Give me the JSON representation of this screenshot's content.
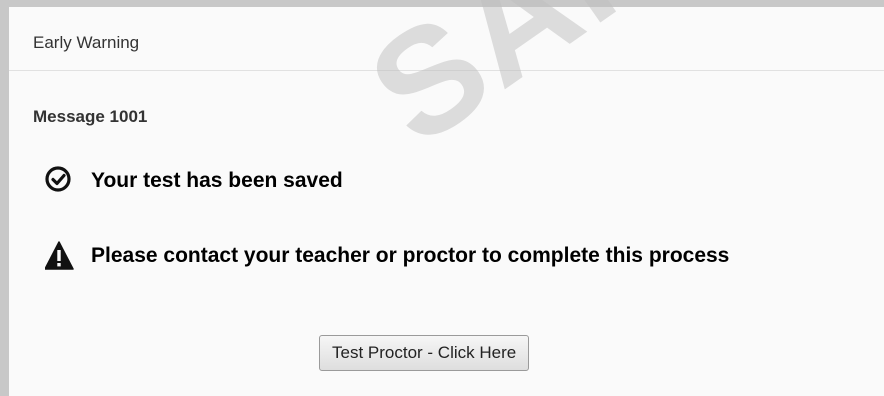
{
  "dialog": {
    "title": "Early Warning",
    "message_id": "Message 1001",
    "saved_text": "Your test has been saved",
    "warning_text": "Please contact your teacher or proctor to complete this process",
    "proctor_button_label": "Test Proctor - Click Here"
  },
  "watermark": "SAMPLE",
  "icons": {
    "saved": "check-circle-icon",
    "warning": "warning-triangle-icon"
  }
}
